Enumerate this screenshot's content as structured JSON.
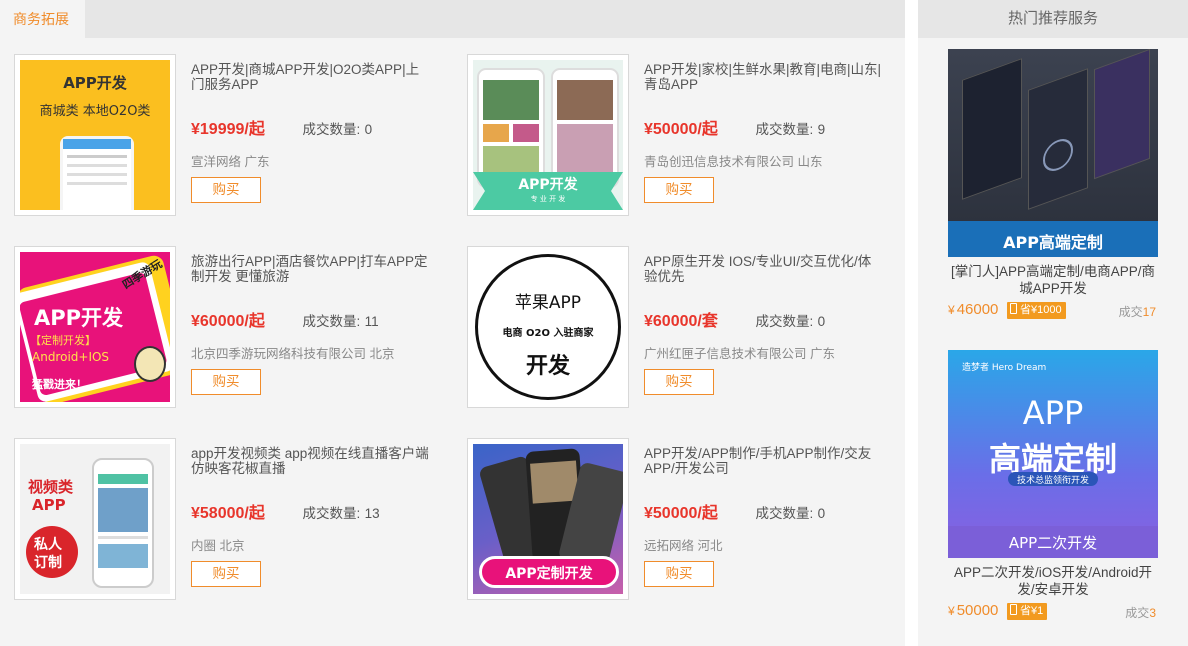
{
  "section": {
    "tab_label": "商务拓展"
  },
  "products": [
    {
      "title": "APP开发|商城APP开发|O2O类APP|上门服务APP",
      "price": "¥19999/起",
      "deal_label": "成交数量:",
      "deal_count": "0",
      "company": "宣洋网络 广东",
      "buy_label": "购买",
      "thumb": {
        "line1": "APP开发",
        "line2": "商城类  本地O2O类",
        "bg": "#fbbf1f"
      }
    },
    {
      "title": "APP开发|家校|生鲜水果|教育|电商|山东|青岛APP",
      "price": "¥50000/起",
      "deal_label": "成交数量:",
      "deal_count": "9",
      "company": "青岛创迅信息技术有限公司 山东",
      "buy_label": "购买",
      "thumb": {
        "line1": "APP开发",
        "line2": "专 业 开 发",
        "bg": "#4ccaa3"
      }
    },
    {
      "title": "旅游出行APP|酒店餐饮APP|打车APP定制开发 更懂旅游",
      "price": "¥60000/起",
      "deal_label": "成交数量:",
      "deal_count": "11",
      "company": "北京四季游玩网络科技有限公司 北京",
      "buy_label": "购买",
      "thumb": {
        "line1": "APP开发",
        "line2": "【定制开发】",
        "line3": "Android+IOS",
        "line4": "猛戳进来！",
        "badge": "四季游玩",
        "bg": "#e8127a"
      }
    },
    {
      "title": "APP原生开发 IOS/专业UI/交互优化/体验优先",
      "price": "¥60000/套",
      "deal_label": "成交数量:",
      "deal_count": "0",
      "company": "广州红匣子信息技术有限公司 广东",
      "buy_label": "购买",
      "thumb": {
        "line1": "苹果APP",
        "line2": "电商 O2O 入驻商家",
        "line3": "开发",
        "bg": "#ffffff"
      }
    },
    {
      "title": "app开发视频类 app视频在线直播客户端 仿映客花椒直播",
      "price": "¥58000/起",
      "deal_label": "成交数量:",
      "deal_count": "13",
      "company": "内圈 北京",
      "buy_label": "购买",
      "thumb": {
        "line1": "视频类",
        "line2": "APP",
        "line3": "私人",
        "line4": "订制",
        "bg": "#f2f2f2"
      }
    },
    {
      "title": "APP开发/APP制作/手机APP制作/交友APP/开发公司",
      "price": "¥50000/起",
      "deal_label": "成交数量:",
      "deal_count": "0",
      "company": "远拓网络 河北",
      "buy_label": "购买",
      "thumb": {
        "line1": "APP定制开发",
        "bg": "#6a5fc8"
      }
    }
  ],
  "sidebar": {
    "title": "热门推荐服务",
    "items": [
      {
        "image_caption": "APP高端定制",
        "title": "[掌门人]APP高端定制/电商APP/商城APP开发",
        "price_symbol": "¥",
        "price": "46000",
        "save_label": "省¥1000",
        "deal_label": "成交",
        "deal_count": "17"
      },
      {
        "image_brand": "造梦者 Hero Dream",
        "image_line1": "APP",
        "image_line2": "高端定制",
        "image_sub": "技术总监领衔开发",
        "image_caption": "APP二次开发",
        "title": "APP二次开发/iOS开发/Android开发/安卓开发",
        "price_symbol": "¥",
        "price": "50000",
        "save_label": "省¥1",
        "deal_label": "成交",
        "deal_count": "3"
      }
    ]
  },
  "colors": {
    "accent": "#f08c2b",
    "price": "#e8352b",
    "panel": "#f4f4f4",
    "header": "#e6e6e6"
  }
}
